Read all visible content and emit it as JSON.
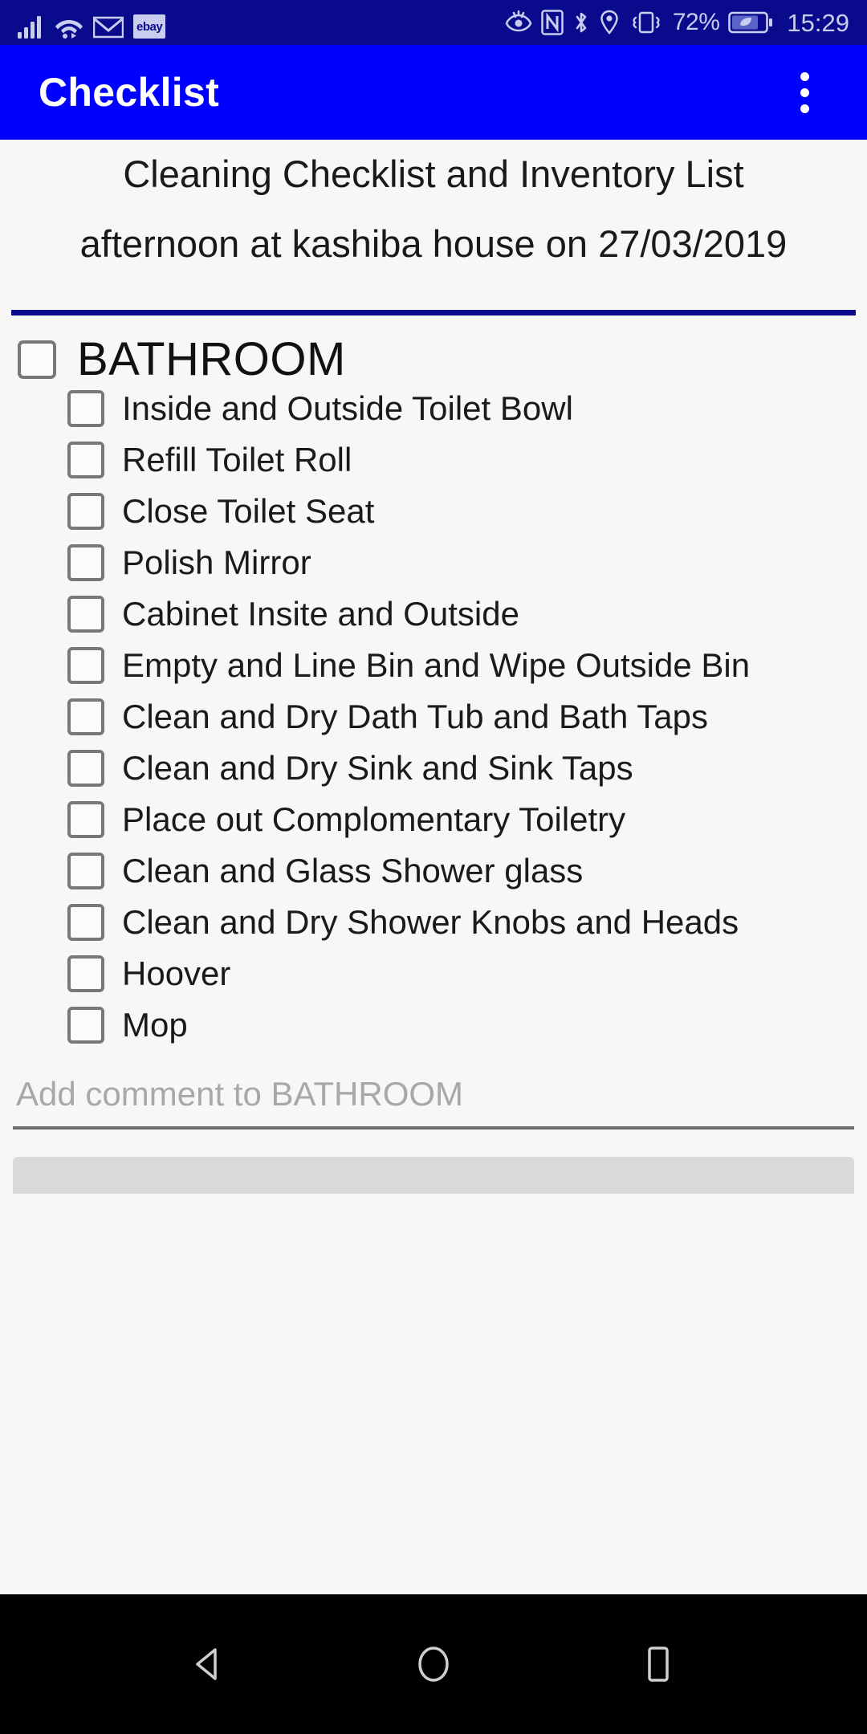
{
  "status_bar": {
    "background": "#0a0a8c",
    "foreground": "#c9cdf0",
    "left_icons": [
      "signal-bars-icon",
      "wifi-icon",
      "email-icon",
      "ebay-icon"
    ],
    "ebay_label": "ebay",
    "right_icons": [
      "eye-comfort-icon",
      "nfc-icon",
      "bluetooth-icon",
      "location-icon",
      "vibrate-icon"
    ],
    "battery_percent": "72%",
    "battery_icon": "battery-power-saving-icon",
    "time": "15:29"
  },
  "app_bar": {
    "title": "Checklist",
    "background": "#0000ff",
    "overflow_icon": "overflow-menu-icon"
  },
  "content": {
    "list_title": "Cleaning Checklist and Inventory List",
    "list_subtitle": "afternoon at kashiba house on 27/03/2019",
    "divider_color": "#0a0a8c",
    "group": {
      "label": "BATHROOM",
      "checked": false,
      "items": [
        {
          "label": "Inside and Outside Toilet Bowl",
          "checked": false
        },
        {
          "label": "Refill Toilet Roll",
          "checked": false
        },
        {
          "label": "Close Toilet Seat",
          "checked": false
        },
        {
          "label": "Polish Mirror",
          "checked": false
        },
        {
          "label": "Cabinet Insite and Outside",
          "checked": false
        },
        {
          "label": "Empty and Line Bin and Wipe Outside Bin",
          "checked": false
        },
        {
          "label": "Clean and Dry Dath Tub and Bath Taps",
          "checked": false
        },
        {
          "label": "Clean and Dry Sink and Sink Taps",
          "checked": false
        },
        {
          "label": "Place out Complomentary Toiletry",
          "checked": false
        },
        {
          "label": "Clean and Glass Shower glass",
          "checked": false
        },
        {
          "label": "Clean and Dry Shower Knobs and Heads",
          "checked": false
        },
        {
          "label": "Hoover",
          "checked": false
        },
        {
          "label": "Mop",
          "checked": false
        }
      ]
    },
    "comment": {
      "placeholder": "Add comment to BATHROOM",
      "value": ""
    }
  },
  "nav_bar": {
    "background": "#000000",
    "buttons": [
      "back-button",
      "home-button",
      "recents-button"
    ]
  }
}
